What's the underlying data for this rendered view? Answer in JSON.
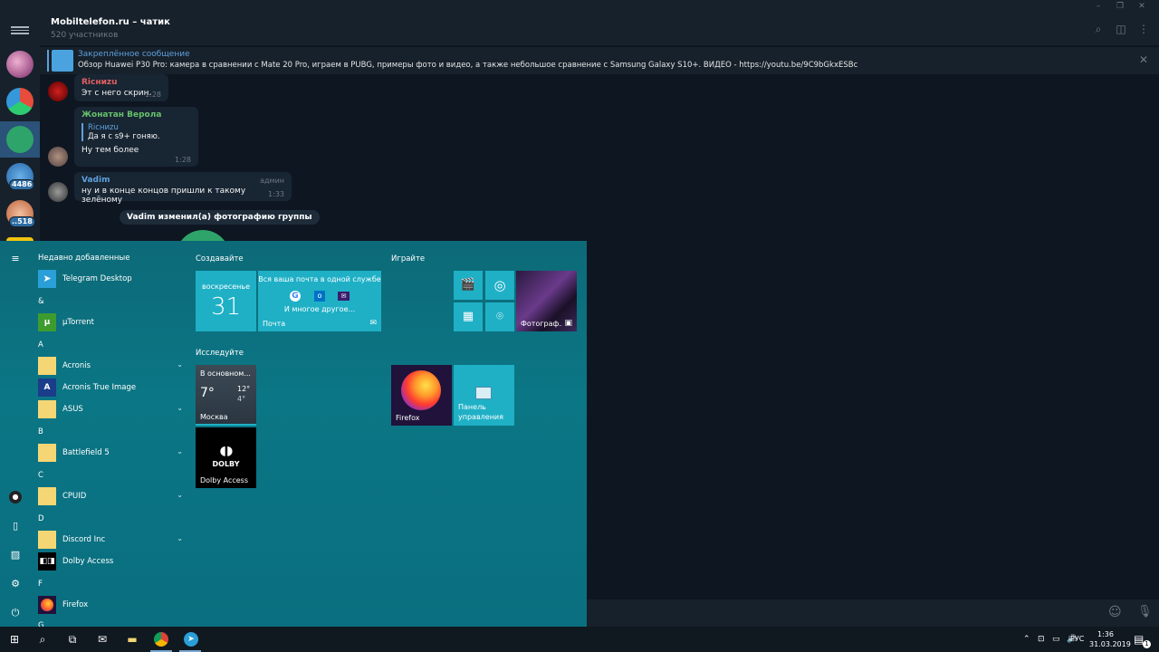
{
  "window": {
    "minimize_icon": "minimize-icon",
    "maximize_icon": "maximize-icon",
    "close_icon": "close-icon"
  },
  "chat": {
    "title": "Mobiltelefon.ru – чатик",
    "subtitle": "520 участников"
  },
  "rail": {
    "badges": [
      "4486",
      "..518"
    ]
  },
  "pinned": {
    "title": "Закреплённое сообщение",
    "text": "Обзор Huawei P30 Pro: камера в сравнении с Mate 20 Pro, играем в PUBG, примеры фото и видео, а также небольшое сравнение с Samsung Galaxy S10+.  ВИДЕО - https://youtu.be/9C9bGkxESBc"
  },
  "messages": [
    {
      "name": "Ricниzu",
      "text": "Эт с него скрин.",
      "time": "1:28",
      "name_color": "#e06060"
    },
    {
      "name": "Жонатан Верола",
      "reply_name": "Ricниzu",
      "reply_text": "Да я с s9+ гоняю.",
      "text": "Ну тем более",
      "time": "1:28",
      "name_color": "#67c16b"
    },
    {
      "name": "Vadim",
      "role": "админ",
      "text": "ну и в конце концов пришли к такому зелёному",
      "time": "1:33",
      "name_color": "#5fa0dd"
    }
  ],
  "service_message": "Vadim изменил(а) фотографию группы",
  "start_menu": {
    "recent_header": "Недавно добавленные",
    "apps": [
      {
        "kind": "app",
        "label": "Telegram Desktop"
      },
      {
        "kind": "letter",
        "label": "&"
      },
      {
        "kind": "app",
        "label": "µTorrent"
      },
      {
        "kind": "letter",
        "label": "A"
      },
      {
        "kind": "folder",
        "label": "Acronis"
      },
      {
        "kind": "app",
        "label": "Acronis True Image"
      },
      {
        "kind": "folder",
        "label": "ASUS"
      },
      {
        "kind": "letter",
        "label": "B"
      },
      {
        "kind": "folder",
        "label": "Battlefield 5"
      },
      {
        "kind": "letter",
        "label": "C"
      },
      {
        "kind": "folder",
        "label": "CPUID"
      },
      {
        "kind": "letter",
        "label": "D"
      },
      {
        "kind": "folder",
        "label": "Discord Inc"
      },
      {
        "kind": "app",
        "label": "Dolby Access"
      },
      {
        "kind": "letter",
        "label": "F"
      },
      {
        "kind": "app",
        "label": "Firefox"
      },
      {
        "kind": "letter",
        "label": "G"
      }
    ],
    "groups": {
      "create": "Создавайте",
      "play": "Играйте",
      "explore": "Исследуйте"
    },
    "calendar": {
      "day": "воскресенье",
      "date": "31"
    },
    "mail": {
      "headline": "Вся ваша почта в одной службе",
      "more": "И многое другое...",
      "label": "Почта"
    },
    "photos": {
      "label": "Фотограф..."
    },
    "weather": {
      "title": "В основном...",
      "temp": "7°",
      "high": "12°",
      "low": "4°",
      "city": "Москва"
    },
    "dolby": {
      "logo": "DOLBY",
      "label": "Dolby Access"
    },
    "firefox": {
      "label": "Firefox"
    },
    "control_panel": {
      "line1": "Панель",
      "line2": "управления"
    }
  },
  "taskbar": {
    "lang": "РУС",
    "time": "1:36",
    "date": "31.03.2019",
    "notif_count": "1"
  },
  "colors": {
    "accent": "#5fa0dd",
    "start_bg": "#0b7685",
    "tile": "#1fb0c6"
  }
}
